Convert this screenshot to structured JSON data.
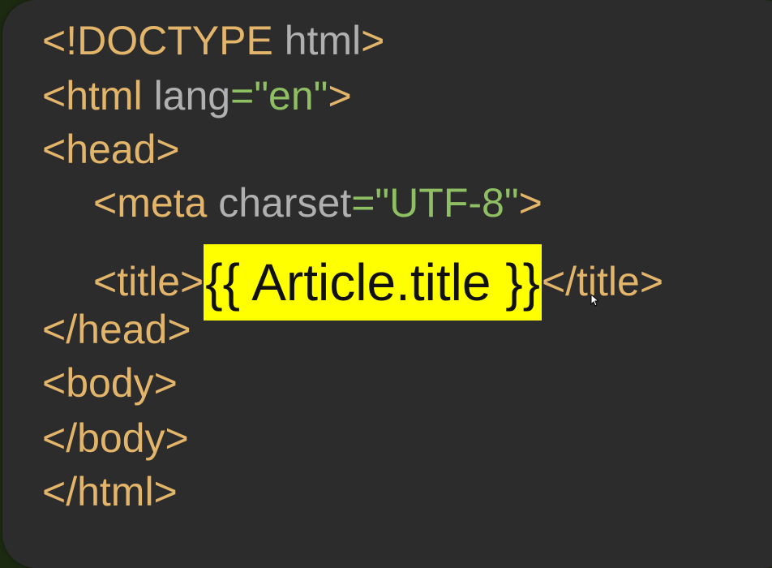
{
  "editor": {
    "lines": {
      "doctype_open": "<!DOCTYPE",
      "doctype_html": " html",
      "doctype_close": ">",
      "html_open": "<html",
      "html_lang_attr": " lang",
      "html_lang_eq": "=",
      "html_lang_val": "\"en\"",
      "html_close": ">",
      "head_open": "<head>",
      "meta_open": "<meta",
      "meta_attr": " charset",
      "meta_eq": "=",
      "meta_val": "\"UTF-8\"",
      "meta_close": ">",
      "title_open": "<title>",
      "title_expr": "{{ Article.title }}",
      "title_close": "</title>",
      "head_close": "</head>",
      "body_open": "<body>",
      "body_close": "</body>",
      "html_end": "</html>"
    }
  },
  "colors": {
    "background": "#2c2c2c",
    "tag": "#e3b56a",
    "attribute": "#b0b0b0",
    "string": "#8fbf63",
    "highlight": "#ffff00"
  }
}
